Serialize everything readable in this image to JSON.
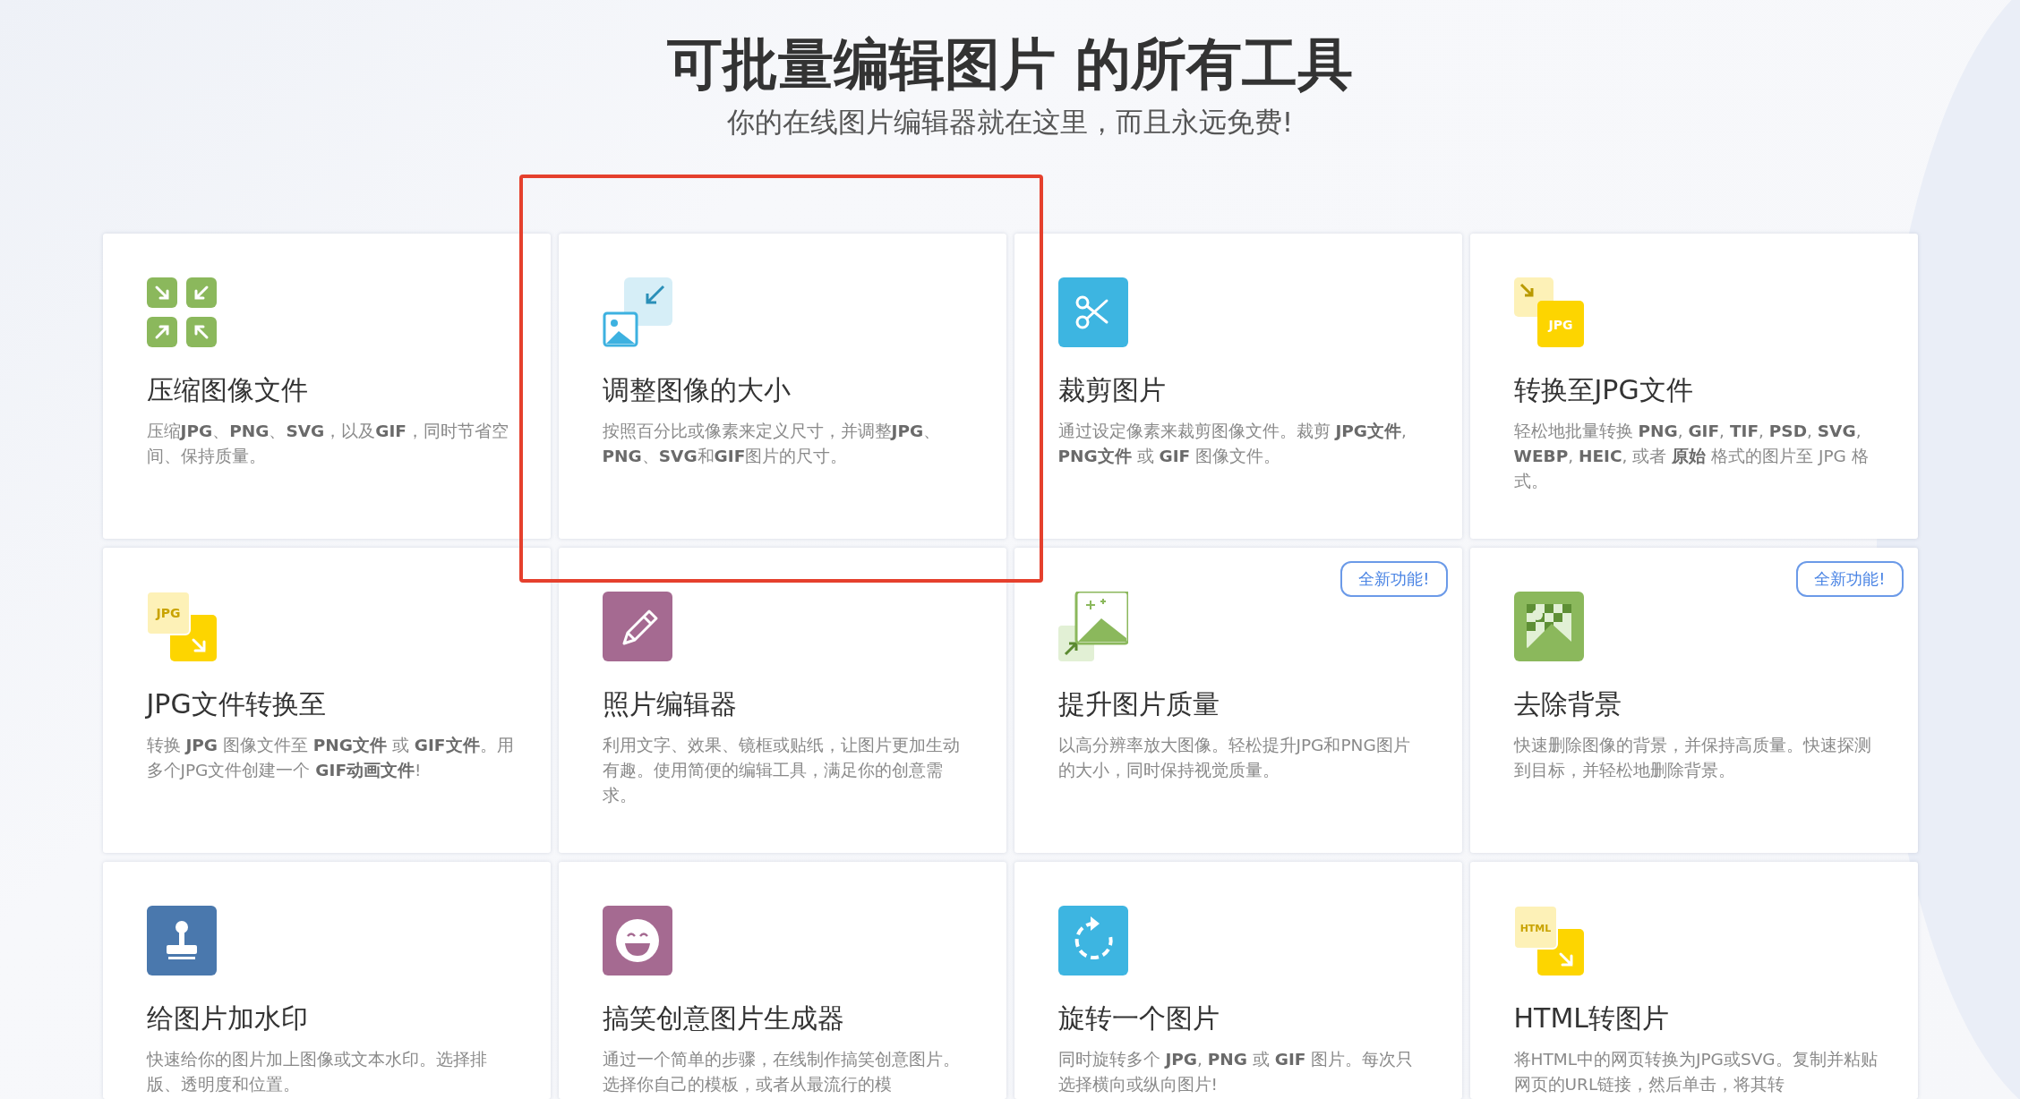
{
  "header": {
    "title": "可批量编辑图片 的所有工具",
    "subtitle": "你的在线图片编辑器就在这里，而且永远免费!"
  },
  "tools": [
    {
      "kind": "compress",
      "title": "压缩图像文件",
      "description": "压缩**JPG**、**PNG**、**SVG**，以及**GIF**，同时节省空间、保持质量。",
      "highlighted": false
    },
    {
      "kind": "resize",
      "title": "调整图像的大小",
      "description": "按照百分比或像素来定义尺寸，并调整**JPG**、**PNG**、**SVG**和**GIF**图片的尺寸。",
      "highlighted": true
    },
    {
      "kind": "crop",
      "title": "裁剪图片",
      "description": "通过设定像素来裁剪图像文件。裁剪 **JPG文件**, **PNG文件** 或 **GIF** 图像文件。",
      "highlighted": false
    },
    {
      "kind": "convert-to",
      "icon_text": "JPG",
      "title": "转换至JPG文件",
      "description": "轻松地批量转换 **PNG**, **GIF**, **TIF**, **PSD**, **SVG**, **WEBP**, **HEIC**, 或者 **原始** 格式的图片至 JPG 格式。",
      "highlighted": false
    },
    {
      "kind": "convert-from",
      "icon_text": "JPG",
      "title": "JPG文件转换至",
      "description": "转换 **JPG** 图像文件至 **PNG文件** 或 **GIF文件**。用多个JPG文件创建一个 **GIF动画文件**!",
      "highlighted": false
    },
    {
      "kind": "edit",
      "title": "照片编辑器",
      "description": "利用文字、效果、镜框或贴纸，让图片更加生动有趣。使用简便的编辑工具，满足你的创意需求。",
      "highlighted": false
    },
    {
      "kind": "upscale",
      "badge": "全新功能!",
      "title": "提升图片质量",
      "description": "以高分辨率放大图像。轻松提升JPG和PNG图片的大小，同时保持视觉质量。",
      "highlighted": false
    },
    {
      "kind": "remove-bg",
      "badge": "全新功能!",
      "title": "去除背景",
      "description": "快速删除图像的背景，并保持高质量。快速探测到目标，并轻松地删除背景。",
      "highlighted": false
    },
    {
      "kind": "watermark",
      "title": "给图片加水印",
      "description": "快速给你的图片加上图像或文本水印。选择排版、透明度和位置。",
      "highlighted": false
    },
    {
      "kind": "meme",
      "title": "搞笑创意图片生成器",
      "description": "通过一个简单的步骤，在线制作搞笑创意图片。选择你自己的模板，或者从最流行的模",
      "highlighted": false
    },
    {
      "kind": "rotate",
      "title": "旋转一个图片",
      "description": "同时旋转多个 **JPG**, **PNG** 或 **GIF** 图片。每次只选择横向或纵向图片!",
      "highlighted": false
    },
    {
      "kind": "html",
      "icon_text": "HTML",
      "title": "HTML转图片",
      "description": "将HTML中的网页转换为JPG或SVG。复制并粘贴网页的URL链接，然后单击，将其转",
      "highlighted": false
    }
  ]
}
